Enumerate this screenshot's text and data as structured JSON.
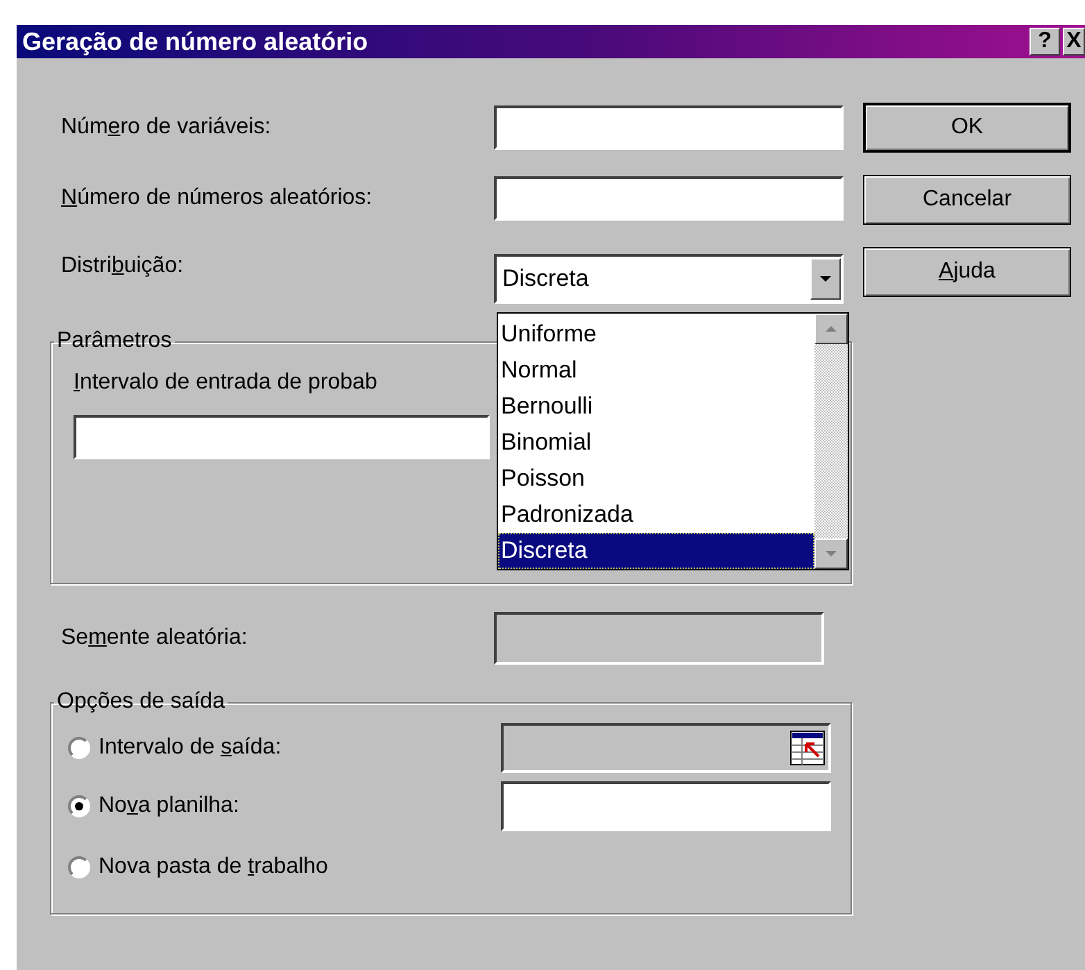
{
  "window": {
    "title": "Geração de número aleatório",
    "help_button": "?",
    "close_button": "X"
  },
  "number_of_variables": {
    "label": {
      "before": "Núm",
      "key": "e",
      "after": "ro de variáveis:"
    },
    "disabled": false
  },
  "number_of_random_numbers": {
    "label": {
      "key": "N",
      "after": "úmero de números aleatórios:"
    },
    "disabled": false
  },
  "distribution": {
    "label": {
      "before": "Distri",
      "key": "b",
      "after": "uição:"
    },
    "value": "Discreta",
    "expanded": true,
    "options": [
      {
        "text": "Uniforme",
        "selected": false
      },
      {
        "text": "Normal",
        "selected": false
      },
      {
        "text": "Bernoulli",
        "selected": false
      },
      {
        "text": "Binomial",
        "selected": false
      },
      {
        "text": "Poisson",
        "selected": false
      },
      {
        "text": "Padronizada",
        "selected": false
      },
      {
        "text": "Discreta",
        "selected": true
      }
    ]
  },
  "parameters": {
    "title": "Parâmetros",
    "range_label": {
      "key": "I",
      "after": "ntervalo de entrada de probab"
    }
  },
  "random_seed": {
    "label": {
      "before": "Se",
      "key": "m",
      "after": "ente aleatória:"
    },
    "disabled": true
  },
  "output_options": {
    "title": "Opções de saída",
    "options": [
      {
        "kind": "range",
        "label": {
          "before": "Intervalo de ",
          "key": "s",
          "after": "aída:"
        },
        "selected": false,
        "disabled": true
      },
      {
        "kind": "field",
        "label": {
          "before": "No",
          "key": "v",
          "after": "a planilha:"
        },
        "selected": true,
        "disabled": false
      },
      {
        "kind": "plain",
        "label": {
          "before": "Nova pasta de ",
          "key": "t",
          "after": "rabalho"
        },
        "selected": false
      }
    ]
  },
  "buttons": [
    {
      "label": {
        "before": "OK"
      },
      "default": true
    },
    {
      "label": {
        "before": "Cancelar"
      },
      "default": false
    },
    {
      "label": {
        "key": "A",
        "after": "juda"
      },
      "default": false
    }
  ]
}
